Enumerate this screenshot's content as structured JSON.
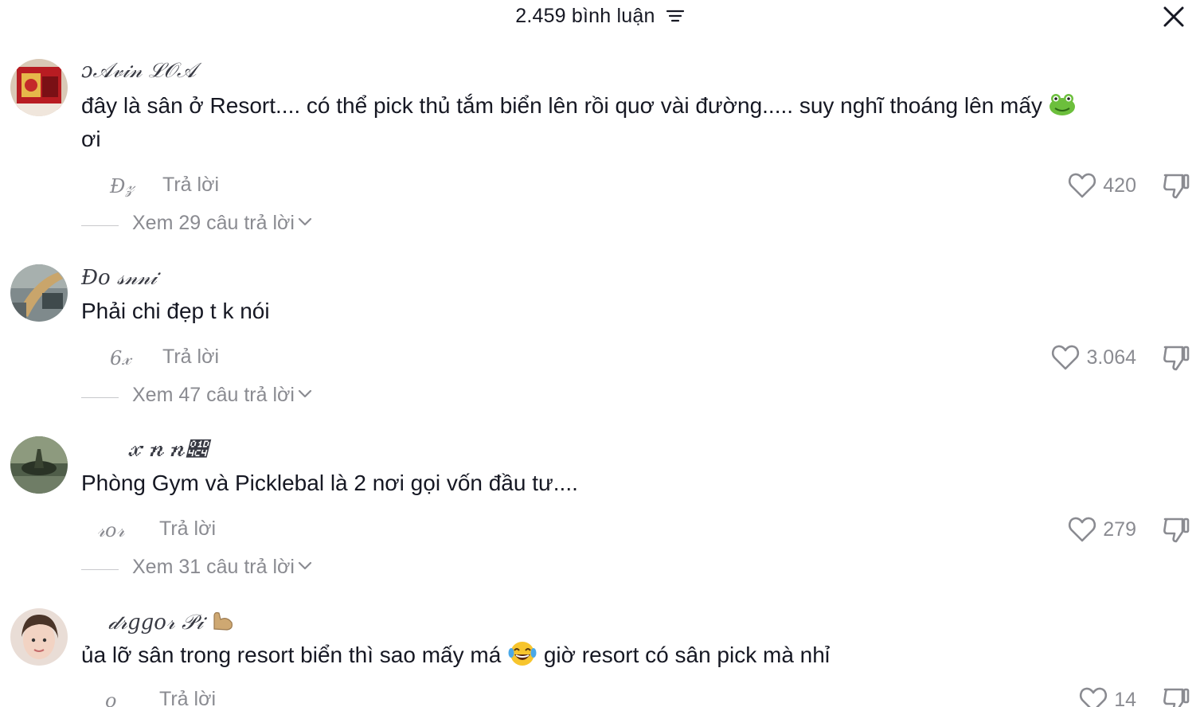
{
  "header": {
    "title": "2.459 bình luận",
    "filter_icon": "filter-icon",
    "close_icon": "close-icon"
  },
  "comments": [
    {
      "username": "ɔ𝒜𝓋𝒾𝓃 ℒ𝒪𝒜",
      "text": "đây là sân ở Resort.... có thể pick thủ tắm biển lên rồi quơ vài đường..... suy nghĩ thoáng lên mấy",
      "text_tail": "ơi",
      "emoji": "frog-emoji",
      "date": "Đ𝓏",
      "reply_label": "Trả lời",
      "likes": "420",
      "view_replies": "Xem 29 câu trả lời"
    },
    {
      "username": "Đo 𝓈𝓃𝓃𝒾",
      "text": "Phải chi đẹp t k nói",
      "date": "6𝓍",
      "reply_label": "Trả lời",
      "likes": "3.064",
      "view_replies": "Xem 47 câu trả lời"
    },
    {
      "username": "𝓍𝓃𝓃𝓄",
      "text": "Phòng Gym và Picklebal là 2 nơi gọi vốn đầu tư....",
      "date": "𝓇𝑜𝓇",
      "reply_label": "Trả lời",
      "likes": "279",
      "view_replies": "Xem 31 câu trả lời"
    },
    {
      "username": "𝒹𝓇𝑔𝑔𝑜𝓇 𝒫𝒾",
      "text_before": "ủa lỡ sân trong resort biển thì sao mấy má",
      "emoji": "laughing-tears-emoji",
      "text_after": "giờ resort có sân pick mà nhỉ",
      "date": "𝑜",
      "reply_label": "Trả lời",
      "likes": "14"
    }
  ],
  "colors": {
    "text": "#161823",
    "muted": "#8a8b91",
    "divider": "#c8c9cc"
  }
}
